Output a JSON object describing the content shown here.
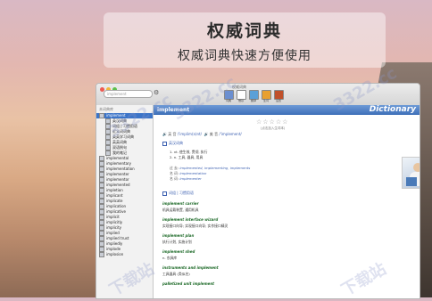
{
  "banner": {
    "title": "权威词典",
    "subtitle": "权威词典快速方便使用"
  },
  "window": {
    "title": "权威词典",
    "search_placeholder": "implement",
    "toolbar_buttons": [
      {
        "label": "词典",
        "icon": "book-icon",
        "color": "#6b8fd0"
      },
      {
        "label": "维基",
        "icon": "wiki-icon",
        "color": "#ffffff"
      },
      {
        "label": "翻译",
        "icon": "translate-icon",
        "color": "#5aa0d8"
      },
      {
        "label": "生词",
        "icon": "wordbook-icon",
        "color": "#e8a030"
      },
      {
        "label": "设置",
        "icon": "settings-icon",
        "color": "#c0502a"
      }
    ]
  },
  "sidebar": {
    "heading": "本词典库",
    "items": [
      {
        "label": "implement",
        "level": "top",
        "selected": true
      },
      {
        "label": "英汉词典",
        "level": "sub"
      },
      {
        "label": "词组 | 习惯用语",
        "level": "sub"
      },
      {
        "label": "近义词词典",
        "level": "sub"
      },
      {
        "label": "英英学习词典",
        "level": "sub"
      },
      {
        "label": "英英词典",
        "level": "sub"
      },
      {
        "label": "双语例句",
        "level": "sub"
      },
      {
        "label": "我的笔记",
        "level": "sub"
      },
      {
        "label": "implemental",
        "level": "top"
      },
      {
        "label": "implementary",
        "level": "top"
      },
      {
        "label": "implementation",
        "level": "top"
      },
      {
        "label": "implementer",
        "level": "top"
      },
      {
        "label": "implementor",
        "level": "top"
      },
      {
        "label": "implemented",
        "level": "top"
      },
      {
        "label": "impletion",
        "level": "top"
      },
      {
        "label": "implicant",
        "level": "top"
      },
      {
        "label": "implicate",
        "level": "top"
      },
      {
        "label": "implication",
        "level": "top"
      },
      {
        "label": "implicative",
        "level": "top"
      },
      {
        "label": "implicit",
        "level": "top"
      },
      {
        "label": "implicitly",
        "level": "top"
      },
      {
        "label": "implicity",
        "level": "top"
      },
      {
        "label": "implied",
        "level": "top"
      },
      {
        "label": "implied trust",
        "level": "top"
      },
      {
        "label": "impliedly",
        "level": "top"
      },
      {
        "label": "implode",
        "level": "top"
      },
      {
        "label": "implosion",
        "level": "top"
      }
    ]
  },
  "content": {
    "word": "implement",
    "brand": "Dictionary",
    "stars": "☆☆☆☆☆",
    "stars_note": "(点击加入生词本)",
    "pron_uk_label": "英 音",
    "pron_uk": "/'implim(ə)nt/",
    "pron_us_label": "美 音",
    "pron_us": "/'implement/",
    "section1": "英汉词典",
    "defs": [
      "1.  vt. 使生效, 贯彻, 执行",
      "2.  n. 工具, 器具, 用具"
    ],
    "forms": [
      {
        "k": "过 去:",
        "v": "implemented, implementing, implements"
      },
      {
        "k": "名 词:",
        "v": "implementation"
      },
      {
        "k": "名 词:",
        "v": "implementer"
      }
    ],
    "section2": "词组 | 习惯用语",
    "phrases": [
      {
        "phrase": "implement carrier",
        "def": "机具运载装置, 通用机具"
      },
      {
        "phrase": "implement interface wizard",
        "def": "实现接口向导; 实现接口向导; 实作接口精灵"
      },
      {
        "phrase": "implement plan",
        "def": "执行计划, 实施计划"
      },
      {
        "phrase": "implement shed",
        "def": "n. 农具库"
      },
      {
        "phrase": "instruments and implement",
        "def": "工具器具 (类似名)"
      },
      {
        "phrase": "palletized unit implement",
        "def": ""
      }
    ]
  },
  "watermarks": [
    "3322.cc",
    "3322.cc",
    "下载站",
    "3322.cc",
    "下载站"
  ]
}
